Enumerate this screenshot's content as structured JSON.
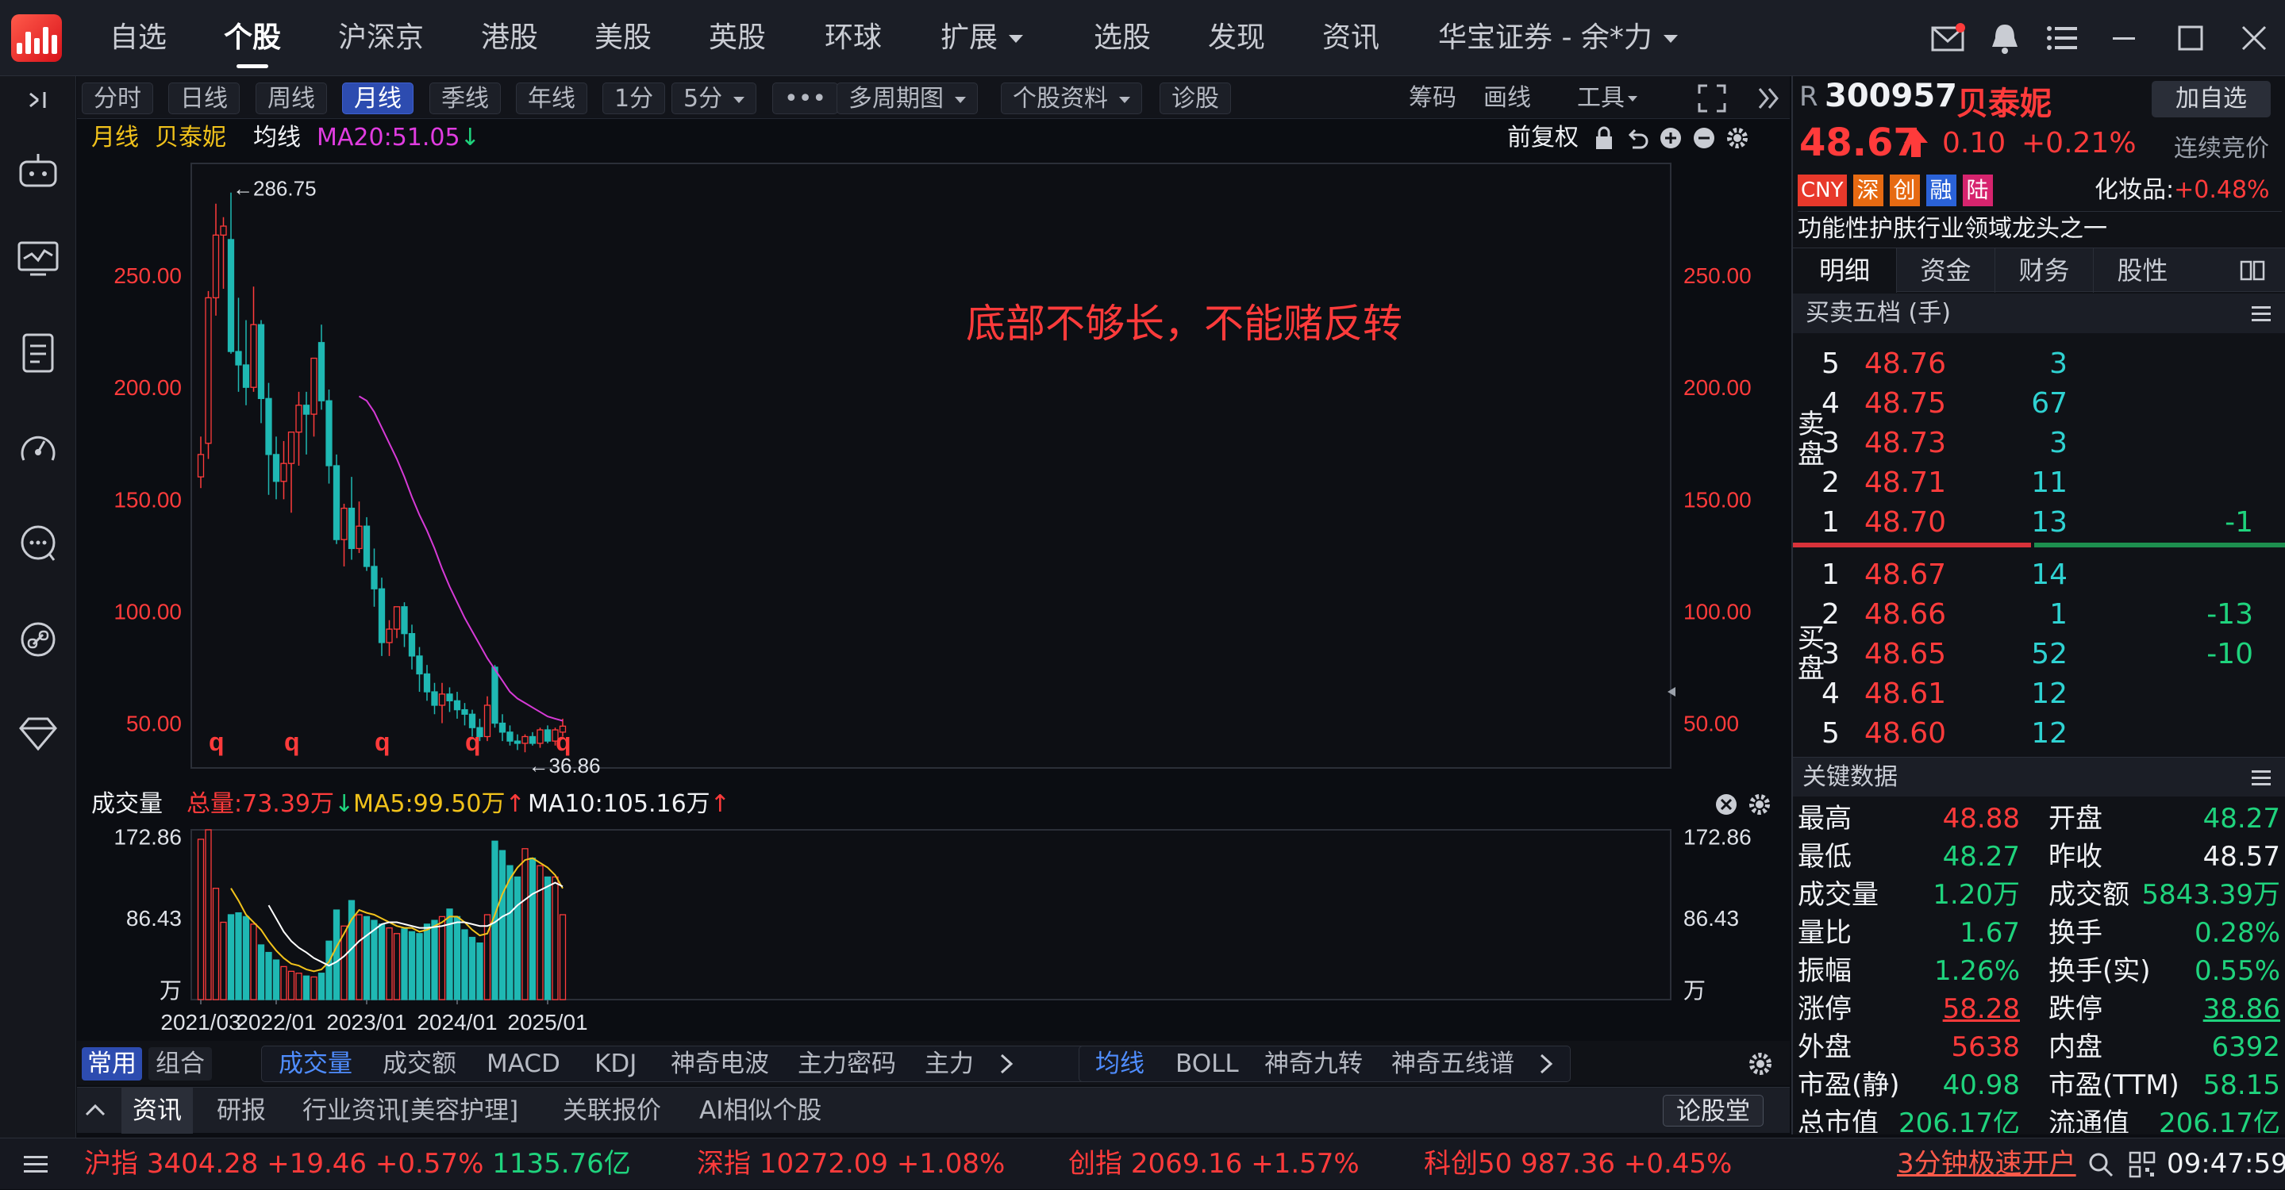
{
  "topnav": {
    "items": [
      "自选",
      "个股",
      "沪深京",
      "港股",
      "美股",
      "英股",
      "环球",
      "扩展",
      "选股",
      "发现",
      "资讯",
      "华宝证券 - 余*力"
    ],
    "active": "个股"
  },
  "toolbar": {
    "periods": [
      "分时",
      "日线",
      "周线",
      "月线",
      "季线",
      "年线",
      "1分",
      "5分",
      "•••",
      "多周期图",
      "个股资料",
      "诊股"
    ],
    "active": "月线",
    "right_tools": [
      "筹码",
      "画线",
      "工具"
    ]
  },
  "chart_legend": {
    "period": "月线",
    "name": "贝泰妮",
    "ma_type": "均线",
    "ma20": "MA20:51.05",
    "adjust": "前复权"
  },
  "annotation": "底部不够长，不能赌反转",
  "chart_data": {
    "type": "candlestick",
    "ylim": [
      30,
      300
    ],
    "yticks": [
      "250.00",
      "200.00",
      "150.00",
      "100.00",
      "50.00"
    ],
    "high_label": "←286.75",
    "low_label": "←36.86",
    "xtick_labels": [
      "2021/03",
      "2022/01",
      "2023/01",
      "2024/01",
      "2025/01"
    ],
    "markers": [
      "q",
      "q",
      "q",
      "q",
      "q"
    ],
    "candles": [
      [
        160,
        178,
        155,
        170
      ],
      [
        175,
        243,
        168,
        240
      ],
      [
        240,
        282,
        232,
        268
      ],
      [
        268,
        276,
        244,
        272
      ],
      [
        266,
        287,
        215,
        216
      ],
      [
        216,
        240,
        198,
        210
      ],
      [
        210,
        230,
        192,
        200
      ],
      [
        200,
        245,
        198,
        228
      ],
      [
        228,
        230,
        184,
        195
      ],
      [
        195,
        202,
        152,
        170
      ],
      [
        170,
        178,
        150,
        158
      ],
      [
        158,
        176,
        150,
        166
      ],
      [
        166,
        180,
        144,
        180
      ],
      [
        180,
        198,
        165,
        192
      ],
      [
        192,
        198,
        170,
        188
      ],
      [
        188,
        213,
        178,
        213
      ],
      [
        220,
        228,
        190,
        194
      ],
      [
        194,
        199,
        157,
        165
      ],
      [
        165,
        170,
        130,
        132
      ],
      [
        132,
        148,
        120,
        146
      ],
      [
        146,
        160,
        123,
        128
      ],
      [
        128,
        149,
        126,
        138
      ],
      [
        138,
        142,
        118,
        120
      ],
      [
        120,
        128,
        102,
        110
      ],
      [
        110,
        115,
        80,
        86
      ],
      [
        86,
        96,
        80,
        92
      ],
      [
        92,
        102,
        88,
        102
      ],
      [
        102,
        104,
        84,
        90
      ],
      [
        90,
        94,
        74,
        80
      ],
      [
        80,
        84,
        64,
        72
      ],
      [
        72,
        76,
        60,
        64
      ],
      [
        64,
        68,
        54,
        58
      ],
      [
        58,
        68,
        50,
        63
      ],
      [
        63,
        66,
        55,
        60
      ],
      [
        60,
        64,
        52,
        56
      ],
      [
        56,
        59,
        49,
        54
      ],
      [
        54,
        56,
        44,
        48
      ],
      [
        48,
        52,
        42,
        44
      ],
      [
        44,
        62,
        42,
        58
      ],
      [
        75,
        76,
        48,
        50
      ],
      [
        50,
        54,
        42,
        46
      ],
      [
        46,
        49,
        40,
        42
      ],
      [
        42,
        45,
        38,
        41
      ],
      [
        41,
        45,
        37,
        44
      ],
      [
        44,
        46,
        40,
        41
      ],
      [
        41,
        48,
        39,
        47
      ],
      [
        47,
        49,
        41,
        42
      ],
      [
        42,
        48,
        40,
        47
      ],
      [
        46,
        52,
        44,
        48.67
      ]
    ],
    "ma20": [
      196,
      194,
      189,
      182,
      175,
      168,
      160,
      151,
      143,
      136,
      128,
      119,
      111,
      104,
      97,
      91,
      85,
      79,
      74,
      69,
      64,
      61,
      59,
      57,
      55,
      53,
      52,
      51.05
    ]
  },
  "volume_legend": {
    "title": "成交量",
    "total": "总量:73.39万",
    "ma5": "MA5:99.50万",
    "ma10": "MA10:105.16万"
  },
  "volume_chart": {
    "yticks": [
      "172.86",
      "86.43",
      "万"
    ],
    "ymax": 180,
    "bars": [
      170,
      180,
      118,
      82,
      90,
      92,
      88,
      80,
      58,
      50,
      42,
      35,
      30,
      28,
      25,
      24,
      28,
      62,
      95,
      78,
      105,
      90,
      88,
      84,
      80,
      76,
      70,
      75,
      72,
      70,
      80,
      84,
      88,
      96,
      88,
      74,
      66,
      60,
      90,
      168,
      158,
      142,
      130,
      160,
      150,
      142,
      130,
      130,
      90
    ],
    "ma5": [
      null,
      null,
      null,
      null,
      118,
      105,
      90,
      82,
      74,
      62,
      52,
      44,
      38,
      36,
      32,
      30,
      32,
      40,
      56,
      70,
      85,
      95,
      92,
      90,
      86,
      82,
      78,
      76,
      76,
      72,
      74,
      78,
      82,
      88,
      88,
      82,
      74,
      68,
      70,
      90,
      112,
      128,
      140,
      148,
      150,
      145,
      140,
      132,
      118
    ],
    "ma10": [
      null,
      null,
      null,
      null,
      null,
      null,
      null,
      null,
      null,
      100,
      86,
      72,
      62,
      55,
      50,
      44,
      40,
      36,
      40,
      46,
      54,
      62,
      68,
      74,
      80,
      82,
      82,
      80,
      78,
      76,
      76,
      77,
      78,
      80,
      82,
      82,
      80,
      78,
      78,
      82,
      88,
      92,
      100,
      106,
      112,
      116,
      120,
      124,
      120
    ]
  },
  "indicator_tabs": {
    "group": [
      "常用",
      "组合"
    ],
    "indicators": [
      "成交量",
      "成交额",
      "MACD",
      "KDJ",
      "神奇电波",
      "主力密码",
      "主力"
    ],
    "overlays": [
      "均线",
      "BOLL",
      "神奇九转",
      "神奇五线谱"
    ]
  },
  "bottom_tabs": [
    "资讯",
    "研报",
    "行业资讯[美容护理]",
    "关联报价",
    "AI相似个股"
  ],
  "bottom_right_button": "论股堂",
  "stock": {
    "prefix": "R",
    "code": "300957",
    "name": "贝泰妮",
    "add_label": "加自选",
    "price": "48.67",
    "change": "0.10",
    "change_pct": "+0.21%",
    "auction": "连续竞价",
    "tags": [
      "CNY",
      "深",
      "创",
      "融",
      "陆"
    ],
    "tag_colors": [
      "#e8392b",
      "#e66a12",
      "#e66a12",
      "#2a62d8",
      "#d6246e"
    ],
    "sector": "化妆品:",
    "sector_change": "+0.48%",
    "desc": "功能性护肤行业领域龙头之一"
  },
  "panel_tabs": [
    "明细",
    "资金",
    "财务",
    "股性"
  ],
  "orderbook": {
    "title": "买卖五档 (手)",
    "sell_label": "卖盘",
    "buy_label": "买盘",
    "sell": [
      {
        "lvl": "5",
        "price": "48.76",
        "vol": "3",
        "chg": ""
      },
      {
        "lvl": "4",
        "price": "48.75",
        "vol": "67",
        "chg": ""
      },
      {
        "lvl": "3",
        "price": "48.73",
        "vol": "3",
        "chg": ""
      },
      {
        "lvl": "2",
        "price": "48.71",
        "vol": "11",
        "chg": ""
      },
      {
        "lvl": "1",
        "price": "48.70",
        "vol": "13",
        "chg": "-1"
      }
    ],
    "buy": [
      {
        "lvl": "1",
        "price": "48.67",
        "vol": "14",
        "chg": ""
      },
      {
        "lvl": "2",
        "price": "48.66",
        "vol": "1",
        "chg": "-13"
      },
      {
        "lvl": "3",
        "price": "48.65",
        "vol": "52",
        "chg": "-10"
      },
      {
        "lvl": "4",
        "price": "48.61",
        "vol": "12",
        "chg": ""
      },
      {
        "lvl": "5",
        "price": "48.60",
        "vol": "12",
        "chg": ""
      }
    ]
  },
  "key_data": {
    "title": "关键数据",
    "rows": [
      [
        {
          "k": "最高",
          "v": "48.88",
          "c": "red"
        },
        {
          "k": "开盘",
          "v": "48.27",
          "c": "green"
        }
      ],
      [
        {
          "k": "最低",
          "v": "48.27",
          "c": "green"
        },
        {
          "k": "昨收",
          "v": "48.57",
          "c": "white"
        }
      ],
      [
        {
          "k": "成交量",
          "v": "1.20万",
          "c": "green"
        },
        {
          "k": "成交额",
          "v": "5843.39万",
          "c": "green"
        }
      ],
      [
        {
          "k": "量比",
          "v": "1.67",
          "c": "green"
        },
        {
          "k": "换手",
          "v": "0.28%",
          "c": "green"
        }
      ],
      [
        {
          "k": "振幅",
          "v": "1.26%",
          "c": "green"
        },
        {
          "k": "换手(实)",
          "v": "0.55%",
          "c": "green"
        }
      ],
      [
        {
          "k": "涨停",
          "v": "58.28",
          "c": "red"
        },
        {
          "k": "跌停",
          "v": "38.86",
          "c": "green"
        }
      ],
      [
        {
          "k": "外盘",
          "v": "5638",
          "c": "red"
        },
        {
          "k": "内盘",
          "v": "6392",
          "c": "green"
        }
      ],
      [
        {
          "k": "市盈(静)",
          "v": "40.98",
          "c": "green"
        },
        {
          "k": "市盈(TTM)",
          "v": "58.15",
          "c": "green"
        }
      ],
      [
        {
          "k": "总市值",
          "v": "206.17亿",
          "c": "green"
        },
        {
          "k": "流通值",
          "v": "206.17亿",
          "c": "green"
        }
      ]
    ]
  },
  "statusbar": {
    "indices": [
      {
        "name": "沪指",
        "value": "3404.28",
        "chg": "+19.46",
        "pct": "+0.57%",
        "amount": "1135.76亿"
      },
      {
        "name": "深指",
        "value": "10272.09",
        "chg": "",
        "pct": "+1.08%",
        "amount": ""
      },
      {
        "name": "创指",
        "value": "2069.16",
        "chg": "",
        "pct": "+1.57%",
        "amount": ""
      },
      {
        "name": "科创50",
        "value": "987.36",
        "chg": "",
        "pct": "+0.45%",
        "amount": ""
      }
    ],
    "promo": "3分钟极速开户",
    "time": "09:47:59"
  },
  "colors": {
    "up": "#ff3b3b",
    "down": "#1fb8b3",
    "ma20": "#d63ad6",
    "ma5": "#f1c21b",
    "ma10": "#ffffff",
    "accent": "#2d4cb0"
  }
}
